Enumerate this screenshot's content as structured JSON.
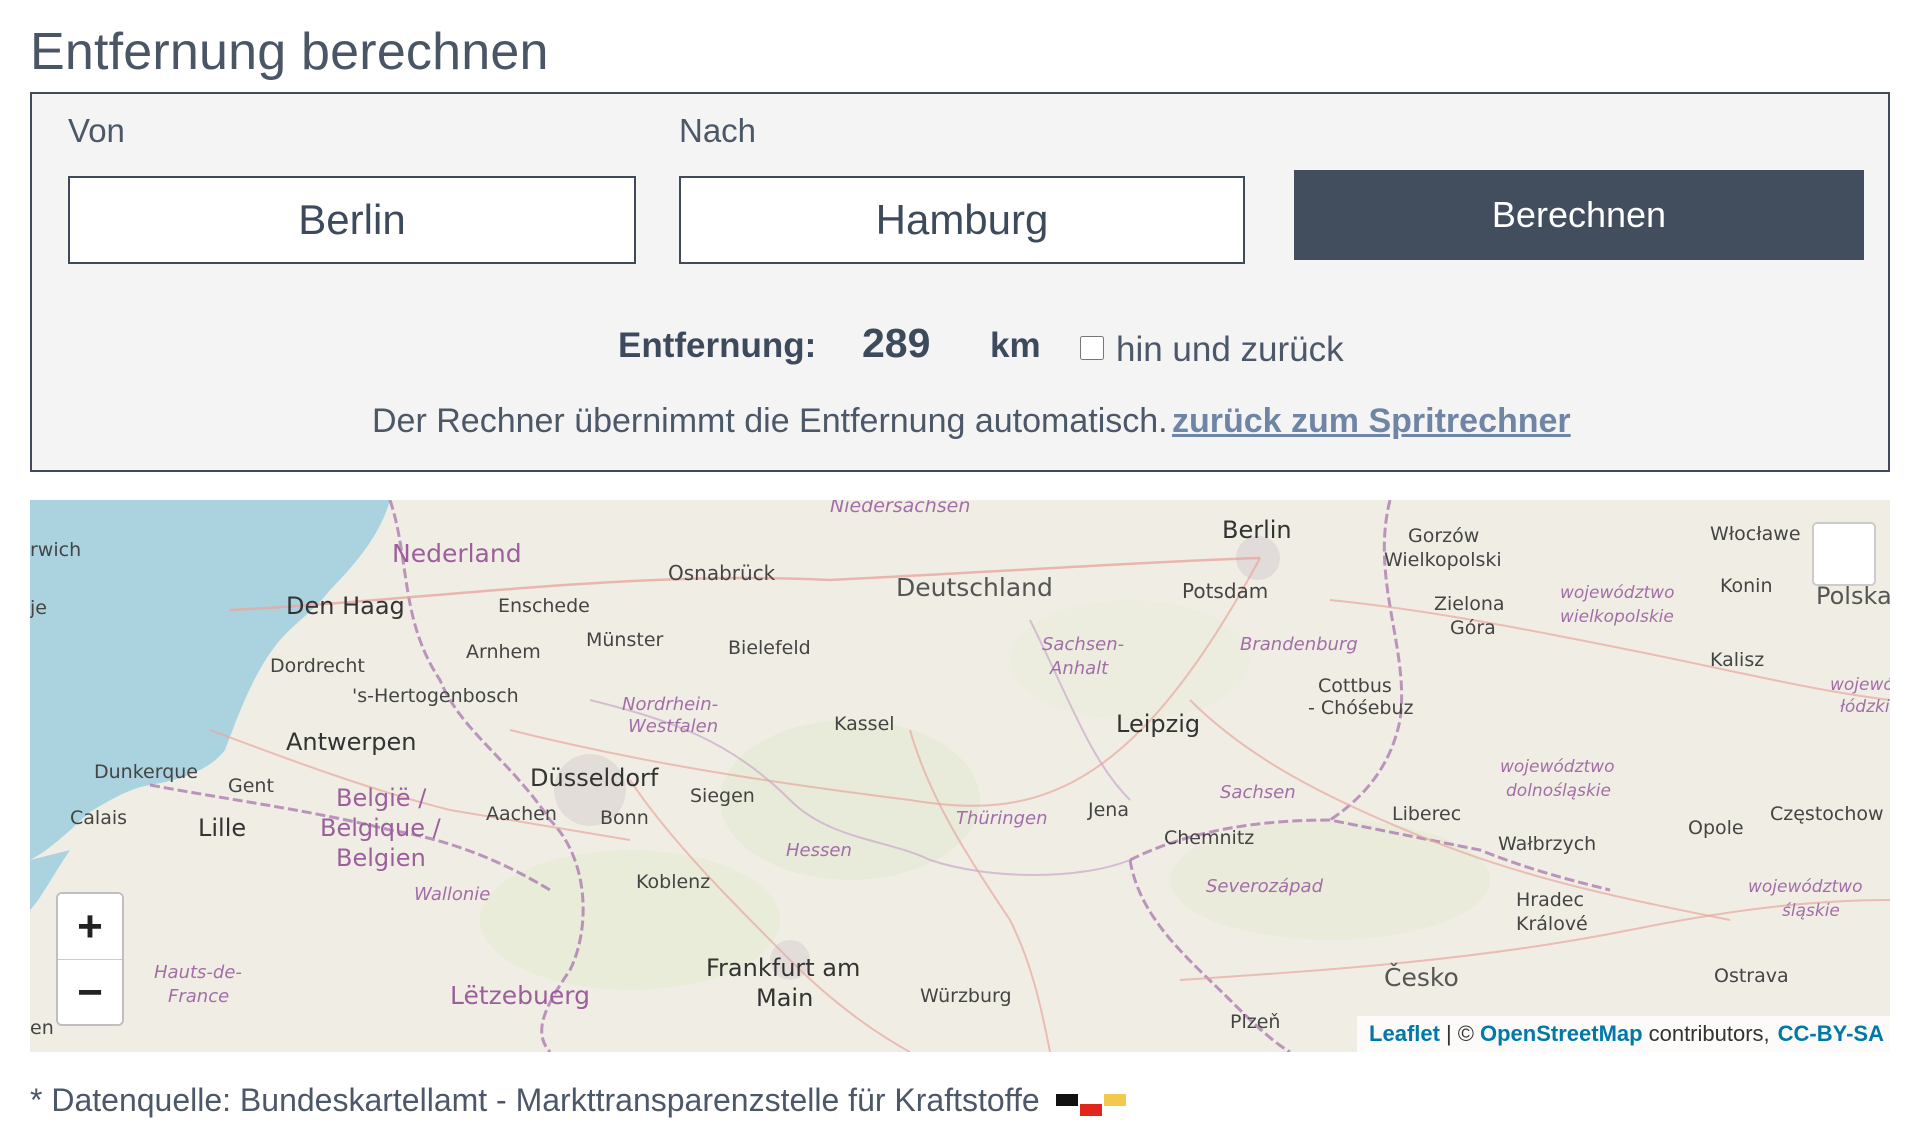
{
  "page_title": "Entfernung berechnen",
  "form": {
    "from_label": "Von",
    "from_value": "Berlin",
    "to_label": "Nach",
    "to_value": "Hamburg",
    "submit_label": "Berechnen"
  },
  "result": {
    "label": "Entfernung:",
    "value": "289",
    "unit": "km",
    "roundtrip_label": "hin und zurück",
    "roundtrip_checked": false
  },
  "note": "Der Rechner übernimmt die Entfernung automatisch.",
  "back_link": "zurück zum Spritrechner",
  "map": {
    "zoom_in": "+",
    "zoom_out": "−",
    "attribution": {
      "leaflet": "Leaflet",
      "sep": "| ©",
      "osm": "OpenStreetMap",
      "contributors": "contributors,",
      "license": "CC-BY-SA"
    },
    "labels": [
      {
        "id": "niedersachsen",
        "text": "Niedersachsen"
      },
      {
        "id": "berlin",
        "text": "Berlin"
      },
      {
        "id": "gorzow",
        "text": "Gorzów"
      },
      {
        "id": "wielkopolski",
        "text": "Wielkopolski"
      },
      {
        "id": "wloclawek",
        "text": "Włocławe"
      },
      {
        "id": "norwich",
        "text": "rwich"
      },
      {
        "id": "nederland",
        "text": "Nederland"
      },
      {
        "id": "osnabrueck",
        "text": "Osnabrück"
      },
      {
        "id": "deutschland",
        "text": "Deutschland"
      },
      {
        "id": "potsdam",
        "text": "Potsdam"
      },
      {
        "id": "zielona",
        "text": "Zielona"
      },
      {
        "id": "gora",
        "text": "Góra"
      },
      {
        "id": "woj-wlkp",
        "text": "województwo"
      },
      {
        "id": "wielkopolskie",
        "text": "wielkopolskie"
      },
      {
        "id": "konin",
        "text": "Konin"
      },
      {
        "id": "polska",
        "text": "Polska"
      },
      {
        "id": "je",
        "text": "je"
      },
      {
        "id": "den-haag",
        "text": "Den Haag"
      },
      {
        "id": "enschede",
        "text": "Enschede"
      },
      {
        "id": "muenster",
        "text": "Münster"
      },
      {
        "id": "bielefeld",
        "text": "Bielefeld"
      },
      {
        "id": "sachsen-anhalt-1",
        "text": "Sachsen-"
      },
      {
        "id": "sachsen-anhalt-2",
        "text": "Anhalt"
      },
      {
        "id": "brandenburg",
        "text": "Brandenburg"
      },
      {
        "id": "kalisz",
        "text": "Kalisz"
      },
      {
        "id": "arnhem",
        "text": "Arnhem"
      },
      {
        "id": "dordrecht",
        "text": "Dordrecht"
      },
      {
        "id": "cottbus",
        "text": "Cottbus"
      },
      {
        "id": "chosebuz",
        "text": "- Chóśebuz"
      },
      {
        "id": "wojew-r",
        "text": "wojewód"
      },
      {
        "id": "lodzkie",
        "text": "łódzki"
      },
      {
        "id": "hertogenbosch",
        "text": "'s-Hertogenbosch"
      },
      {
        "id": "nrw-1",
        "text": "Nordrhein-"
      },
      {
        "id": "nrw-2",
        "text": "Westfalen"
      },
      {
        "id": "kassel",
        "text": "Kassel"
      },
      {
        "id": "leipzig",
        "text": "Leipzig"
      },
      {
        "id": "antwerpen",
        "text": "Antwerpen"
      },
      {
        "id": "woj-dln",
        "text": "województwo"
      },
      {
        "id": "dolnoslaskie",
        "text": "dolnośląskie"
      },
      {
        "id": "dunkerque",
        "text": "Dunkerque"
      },
      {
        "id": "gent",
        "text": "Gent"
      },
      {
        "id": "duesseldorf",
        "text": "Düsseldorf"
      },
      {
        "id": "sachsen",
        "text": "Sachsen"
      },
      {
        "id": "czestochowa",
        "text": "Częstochow"
      },
      {
        "id": "belgie",
        "text": "België /"
      },
      {
        "id": "siegen",
        "text": "Siegen"
      },
      {
        "id": "aachen",
        "text": "Aachen"
      },
      {
        "id": "calais",
        "text": "Calais"
      },
      {
        "id": "bonn",
        "text": "Bonn"
      },
      {
        "id": "thueringen",
        "text": "Thüringen"
      },
      {
        "id": "jena",
        "text": "Jena"
      },
      {
        "id": "liberec",
        "text": "Liberec"
      },
      {
        "id": "opole",
        "text": "Opole"
      },
      {
        "id": "lille",
        "text": "Lille"
      },
      {
        "id": "belgique",
        "text": "Belgique /"
      },
      {
        "id": "chemnitz",
        "text": "Chemnitz"
      },
      {
        "id": "walbrzych",
        "text": "Wałbrzych"
      },
      {
        "id": "hessen",
        "text": "Hessen"
      },
      {
        "id": "belgien",
        "text": "Belgien"
      },
      {
        "id": "koblenz",
        "text": "Koblenz"
      },
      {
        "id": "severozapad",
        "text": "Severozápad"
      },
      {
        "id": "woj-sl",
        "text": "województwo"
      },
      {
        "id": "wallonie",
        "text": "Wallonie"
      },
      {
        "id": "hradec",
        "text": "Hradec"
      },
      {
        "id": "slaskie",
        "text": "śląskie"
      },
      {
        "id": "kralove",
        "text": "Králové"
      },
      {
        "id": "frankfurt",
        "text": "Frankfurt am"
      },
      {
        "id": "hauts",
        "text": "Hauts-de-"
      },
      {
        "id": "ostrava",
        "text": "Ostrava"
      },
      {
        "id": "cesko",
        "text": "Česko"
      },
      {
        "id": "france",
        "text": "France"
      },
      {
        "id": "letzebuerg",
        "text": "Lëtzebuerg"
      },
      {
        "id": "main",
        "text": "Main"
      },
      {
        "id": "wuerzburg",
        "text": "Würzburg"
      },
      {
        "id": "plzen",
        "text": "Plzeň"
      },
      {
        "id": "en",
        "text": "en"
      }
    ]
  },
  "footer": "* Datenquelle: Bundeskartellamt - Markttransparenzstelle für Kraftstoffe",
  "colors": {
    "primary": "#424d5e",
    "link": "#6f85a6",
    "sea": "#aad3df",
    "land": "#f0eee4",
    "border": "#a36ea8"
  }
}
